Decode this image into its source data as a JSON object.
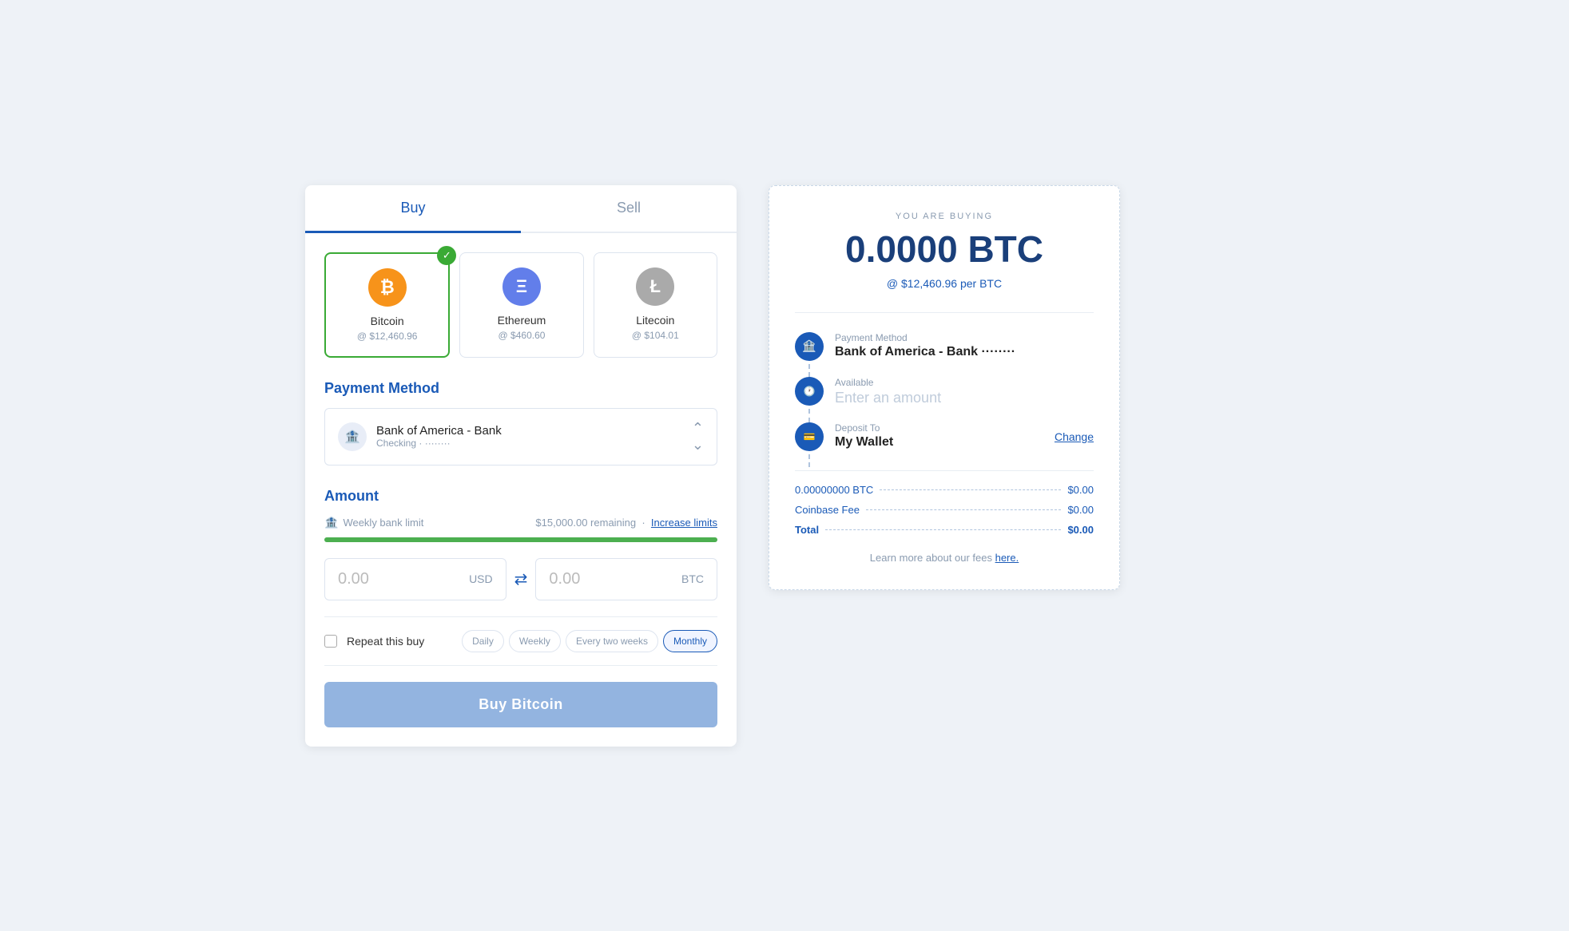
{
  "tabs": [
    {
      "label": "Buy",
      "active": true
    },
    {
      "label": "Sell",
      "active": false
    }
  ],
  "crypto_cards": [
    {
      "id": "btc",
      "name": "Bitcoin",
      "price": "@ $12,460.96",
      "symbol": "₿",
      "selected": true,
      "type": "btc"
    },
    {
      "id": "eth",
      "name": "Ethereum",
      "price": "@ $460.60",
      "symbol": "Ξ",
      "selected": false,
      "type": "eth"
    },
    {
      "id": "ltc",
      "name": "Litecoin",
      "price": "@ $104.01",
      "symbol": "Ł",
      "selected": false,
      "type": "ltc"
    }
  ],
  "payment": {
    "section_title": "Payment Method",
    "bank_name": "Bank of America - Bank",
    "bank_sub": "Checking · ········"
  },
  "amount": {
    "section_title": "Amount",
    "limit_label": "Weekly bank limit",
    "limit_remaining": "$15,000.00 remaining",
    "limit_link": "Increase limits",
    "progress_pct": "100",
    "usd_value": "0.00",
    "usd_currency": "USD",
    "btc_value": "0.00",
    "btc_currency": "BTC"
  },
  "repeat": {
    "label": "Repeat this buy",
    "options": [
      "Daily",
      "Weekly",
      "Every two weeks",
      "Monthly"
    ],
    "active_option": "Monthly"
  },
  "buy_button": "Buy Bitcoin",
  "summary": {
    "you_are_buying": "YOU ARE BUYING",
    "btc_amount": "0.0000 BTC",
    "rate": "@ $12,460.96 per BTC",
    "payment_label": "Payment Method",
    "payment_value": "Bank of America - Bank ········",
    "available_label": "Available",
    "available_placeholder": "Enter an amount",
    "deposit_label": "Deposit To",
    "deposit_value": "My Wallet",
    "change_link": "Change",
    "fees": [
      {
        "label": "0.00000000 BTC",
        "amount": "$0.00"
      },
      {
        "label": "Coinbase Fee",
        "amount": "$0.00"
      },
      {
        "label": "Total",
        "amount": "$0.00"
      }
    ],
    "learn_more": "Learn more about our fees",
    "learn_more_link": "here."
  }
}
